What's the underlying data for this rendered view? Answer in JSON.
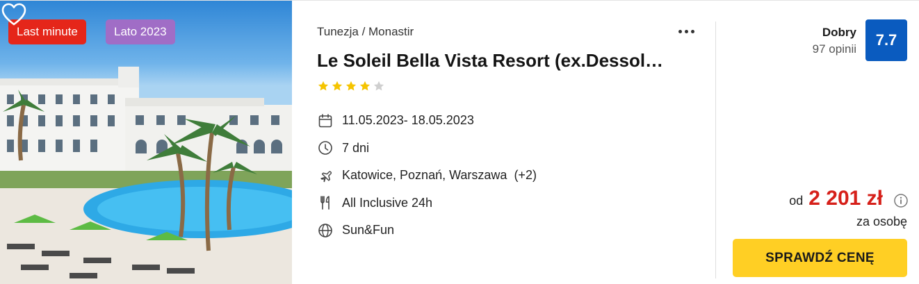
{
  "badges": {
    "last_minute": "Last minute",
    "season": "Lato 2023"
  },
  "hotel": {
    "location": "Tunezja / Monastir",
    "name": "Le Soleil Bella Vista Resort (ex.Dessol…",
    "stars": 4,
    "stars_max": 5
  },
  "details": {
    "dates": "11.05.2023- 18.05.2023",
    "duration": "7 dni",
    "departures": "Katowice, Poznań, Warszawa  (+2)",
    "board": "All Inclusive 24h",
    "program": "Sun&Fun"
  },
  "rating": {
    "label": "Dobry",
    "reviews": "97 opinii",
    "score": "7.7"
  },
  "price": {
    "from_label": "od",
    "amount": "2 201 zł",
    "per_person": "za osobę"
  },
  "cta": {
    "label": "SPRAWDŹ CENĘ"
  },
  "colors": {
    "badge_last_minute": "#e5261a",
    "badge_season": "#a06dc6",
    "star": "#f5c400",
    "score_bg": "#0a5bbf",
    "price": "#d6201a",
    "cta_bg": "#ffcf24"
  },
  "icons": {
    "favorite": "heart-icon",
    "more": "more-dots-icon",
    "dates": "calendar-icon",
    "duration": "clock-icon",
    "departures": "plane-icon",
    "board": "cutlery-icon",
    "program": "globe-icon",
    "price_info": "info-icon"
  }
}
